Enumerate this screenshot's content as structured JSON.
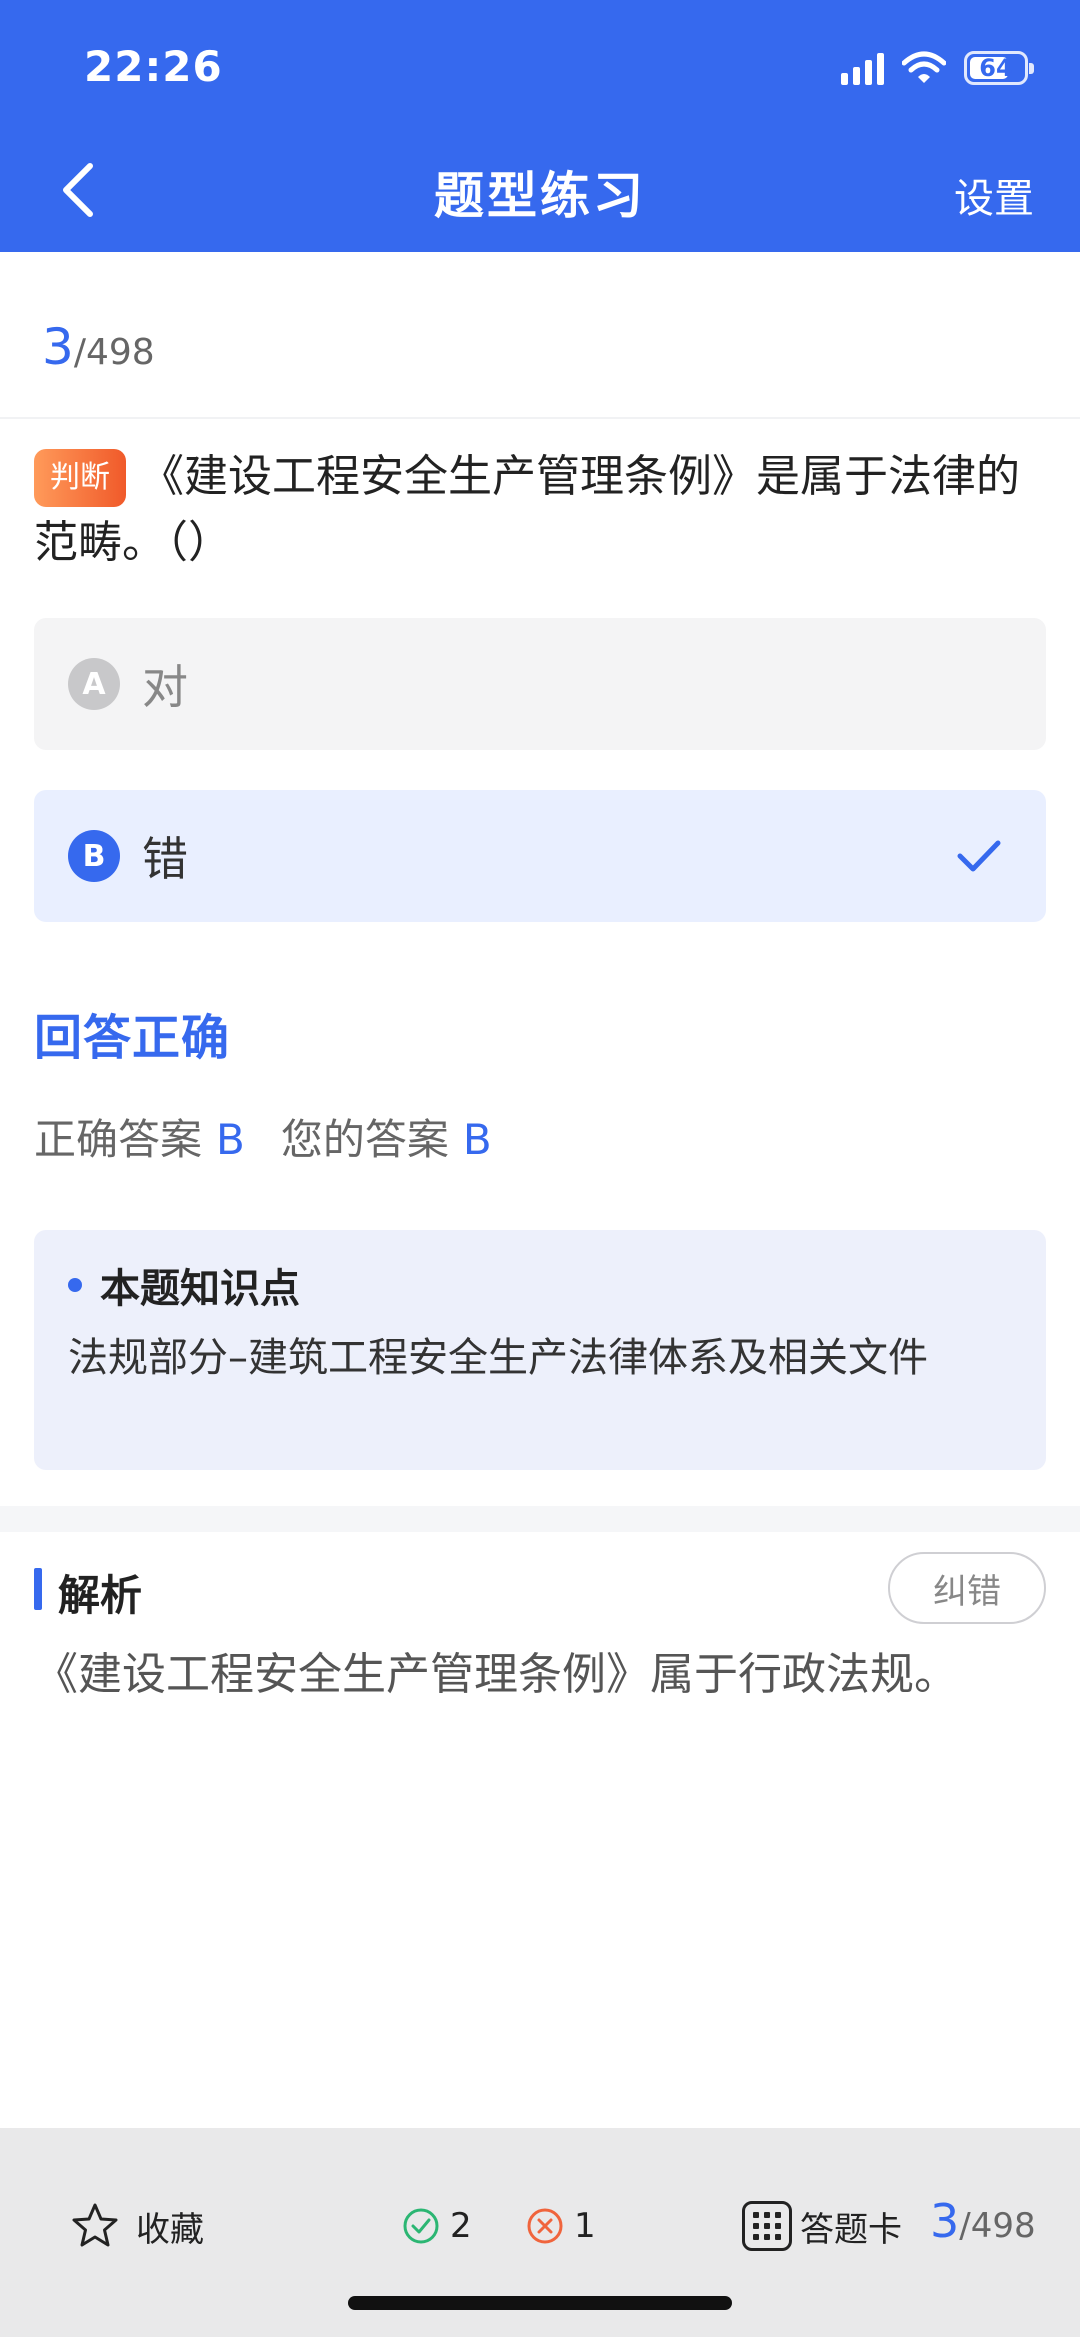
{
  "status_bar": {
    "time": "22:26",
    "battery": "64"
  },
  "nav": {
    "title": "题型练习",
    "settings": "设置"
  },
  "progress": {
    "current": "3",
    "total": "/498"
  },
  "question": {
    "type_tag": "判断",
    "text": "《建设工程安全生产管理条例》是属于法律的范畴。（）"
  },
  "options": [
    {
      "letter": "A",
      "text": "对",
      "selected": false
    },
    {
      "letter": "B",
      "text": "错",
      "selected": true
    }
  ],
  "result": {
    "title": "回答正确",
    "correct_label": "正确答案",
    "correct_value": "B",
    "yours_label": "您的答案",
    "yours_value": "B"
  },
  "knowledge": {
    "title": "本题知识点",
    "body": "法规部分–建筑工程安全生产法律体系及相关文件"
  },
  "analysis": {
    "title": "解析",
    "correction_button": "纠错",
    "text": "《建设工程安全生产管理条例》属于行政法规。"
  },
  "bottom_bar": {
    "favorite": "收藏",
    "right_count": "2",
    "wrong_count": "1",
    "answer_card": "答题卡",
    "current": "3",
    "total": "/498"
  },
  "colors": {
    "accent": "#3669ee",
    "correct": "#2bb673",
    "wrong": "#f0643c",
    "tag": "#f05a2a"
  }
}
